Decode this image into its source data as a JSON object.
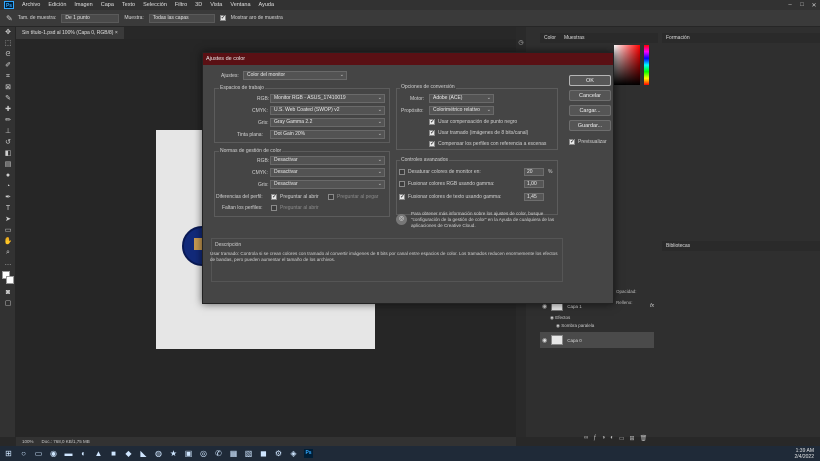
{
  "menubar": {
    "items": [
      "Archivo",
      "Edición",
      "Imagen",
      "Capa",
      "Texto",
      "Selección",
      "Filtro",
      "3D",
      "Vista",
      "Ventana",
      "Ayuda"
    ]
  },
  "optionsbar": {
    "sample_size_label": "Tam. de muestra:",
    "sample_size_value": "De 1 punto",
    "sample_label": "Muestra:",
    "sample_value": "Todas las capas",
    "show_ring_label": "Mostrar aro de muestra"
  },
  "document": {
    "tab_title": "Sin título-1.psd al 100% (Capa 0, RGB/8)",
    "zoom": "100%",
    "doc_info": "Doc.: 768,0 KB/1,75 MB"
  },
  "panels": {
    "color_tab": "Color",
    "swatches_tab": "Muestras",
    "training_tab": "Formación",
    "libraries_tab": "Bibliotecas",
    "layers": [
      {
        "name": "Capa 1",
        "effects_label": "Efectos",
        "effect": "Sombra paralela",
        "fx": "fx"
      },
      {
        "name": "Capa 0"
      }
    ],
    "opacity_label": "Opacidad:",
    "fill_label": "Relleno:"
  },
  "dialog": {
    "title": "Ajustes de color",
    "settings_label": "Ajustes:",
    "settings_value": "Color del monitor",
    "working_spaces_title": "Espacios de trabajo",
    "rgb_label": "RGB:",
    "rgb_value": "Monitor RGB - ASUS_17410019",
    "cmyk_label": "CMYK:",
    "cmyk_value": "U.S. Web Coated (SWOP) v2",
    "gray_label": "Gris:",
    "gray_value": "Gray Gamma 2.2",
    "spot_label": "Tinta plana:",
    "spot_value": "Dot Gain 20%",
    "policies_title": "Normas de gestión de color",
    "policy_rgb_label": "RGB:",
    "policy_rgb_value": "Desactivar",
    "policy_cmyk_label": "CMYK:",
    "policy_cmyk_value": "Desactivar",
    "policy_gray_label": "Gris:",
    "policy_gray_value": "Desactivar",
    "profile_mismatch_label": "Diferencias del perfil:",
    "ask_open_label": "Preguntar al abrir",
    "ask_paste_label": "Preguntar al pegar",
    "missing_profiles_label": "Faltan los perfiles:",
    "ask_open_label_2": "Preguntar al abrir",
    "conversion_title": "Opciones de conversión",
    "engine_label": "Motor:",
    "engine_value": "Adobe (ACE)",
    "intent_label": "Propósito:",
    "intent_value": "Colorimétrico relativo",
    "bpc_label": "Usar compensación de punto negro",
    "dither_label": "Usar tramado (imágenes de 8 bits/canal)",
    "compensate_label": "Compensar los perfiles con referencia a escenas",
    "advanced_title": "Controles avanzados",
    "desaturate_label": "Desaturar colores de monitor en:",
    "desaturate_value": "20",
    "desaturate_unit": "%",
    "blend_rgb_label": "Fusionar colores RGB usando gamma:",
    "blend_rgb_value": "1,00",
    "blend_text_label": "Fusionar colores de texto usando gamma:",
    "blend_text_value": "1,45",
    "info_text": "Para obtener más información sobre los ajustes de color, busque \"configuración de la gestión de color\" en la Ayuda de cualquiera de las aplicaciones de Creative Cloud.",
    "description_title": "Descripción",
    "description_text": "Usar tramado: Controla si se crean colores con tramado al convertir imágenes de 8 bits por canal entre espacios de color. Los tramados reducen enormemente los efectos de bandas, pero pueden aumentar el tamaño de los archivos.",
    "ok_label": "OK",
    "cancel_label": "Cancelar",
    "load_label": "Cargar...",
    "save_label": "Guardar...",
    "preview_label": "Previsualizar"
  },
  "taskbar": {
    "time": "1:39 AM",
    "date": "2/4/2022"
  }
}
